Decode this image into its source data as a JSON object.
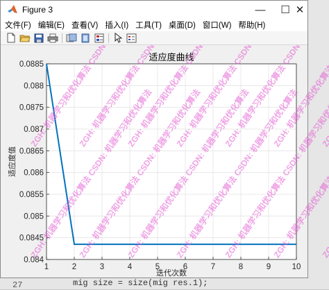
{
  "window": {
    "title": "Figure 3",
    "controls": {
      "minimize": "—",
      "maximize": "☐",
      "close": "✕"
    }
  },
  "menu": [
    "文件(F)",
    "编辑(E)",
    "查看(V)",
    "插入(I)",
    "工具(T)",
    "桌面(D)",
    "窗口(W)",
    "帮助(H)"
  ],
  "toolbar": [
    "new-file-icon",
    "open-folder-icon",
    "save-icon",
    "print-icon",
    "link-icon",
    "brush-icon",
    "colorbar-icon",
    "pointer-icon",
    "legend-icon"
  ],
  "background": {
    "line_number": "27",
    "code": "mig size = size(mig res.1);"
  },
  "watermark": "ZGH: 机器学习和优化算法 CSDN: 机器学习和优化算法",
  "chart_data": {
    "type": "line",
    "title": "适应度曲线",
    "xlabel": "迭代次数",
    "ylabel": "适应度值",
    "x": [
      1,
      2,
      3,
      4,
      5,
      6,
      7,
      8,
      9,
      10
    ],
    "series": [
      {
        "values": [
          0.0885,
          0.08435,
          0.08435,
          0.08435,
          0.08435,
          0.08435,
          0.08435,
          0.08435,
          0.08435,
          0.08435
        ],
        "color": "#0072bd"
      }
    ],
    "xlim": [
      1,
      10
    ],
    "ylim": [
      0.084,
      0.0885
    ],
    "xticks": [
      "1",
      "2",
      "3",
      "4",
      "5",
      "6",
      "7",
      "8",
      "9",
      "10"
    ],
    "yticks": [
      "0.084",
      "0.0845",
      "0.085",
      "0.0855",
      "0.086",
      "0.0865",
      "0.087",
      "0.0875",
      "0.088",
      "0.0885"
    ],
    "grid": true
  }
}
